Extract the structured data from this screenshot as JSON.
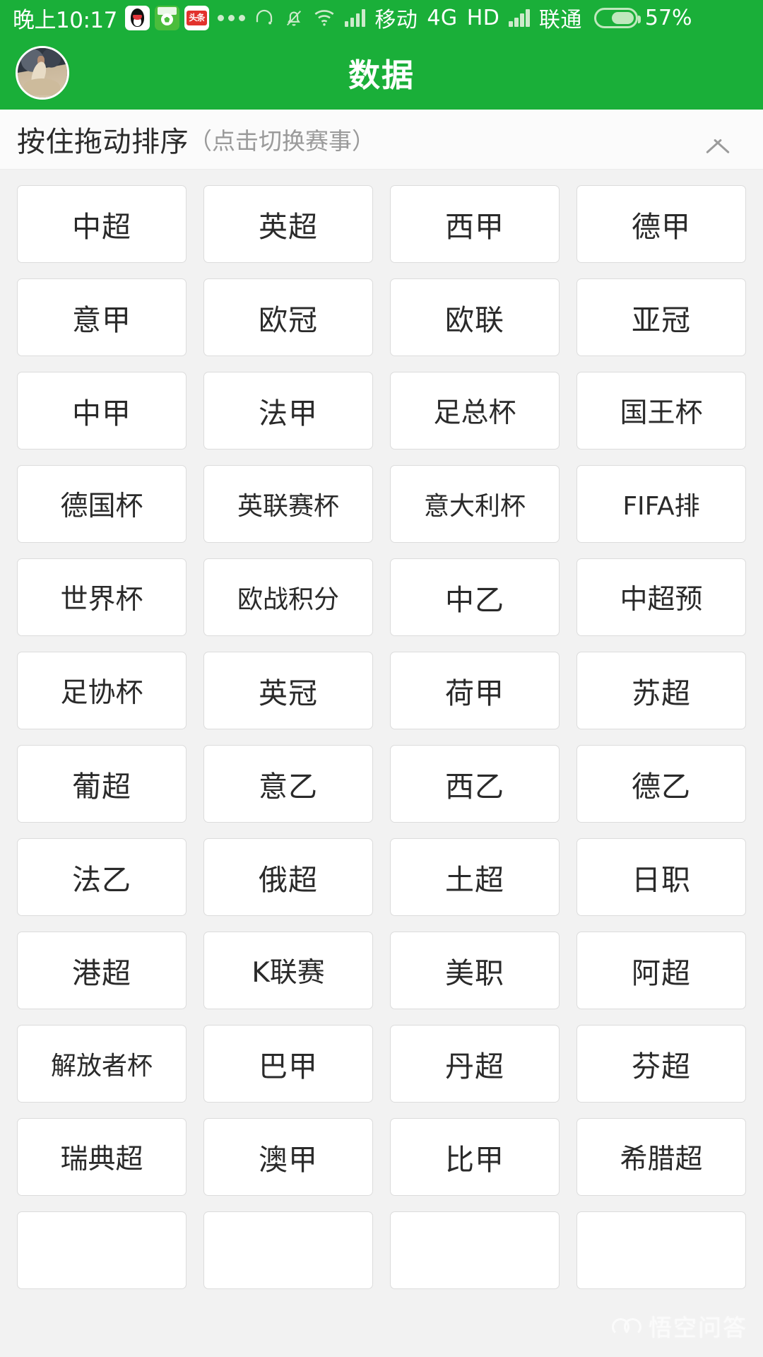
{
  "status_bar": {
    "time": "晚上10:17",
    "app_icons": [
      "qq-icon",
      "football-app-icon",
      "toutiao-icon",
      "more-dots-icon"
    ],
    "toutiao_label": "头条",
    "headset_icon": "headset-icon",
    "mute_icon": "bell-muted-icon",
    "wifi_icon": "wifi-icon",
    "signal_icon_1": "signal-bars-icon",
    "carrier_1": "移动",
    "network_type": "4G",
    "hd_label": "HD",
    "signal_icon_2": "signal-bars-icon",
    "carrier_2": "联通",
    "battery_icon": "battery-icon",
    "battery_percent": "57%"
  },
  "header": {
    "avatar": "user-avatar",
    "title": "数据"
  },
  "section": {
    "title": "按住拖动排序",
    "subtitle": "（点击切换赛事）",
    "collapse_icon": "chevron-up-icon"
  },
  "grid": {
    "columns": 4,
    "leagues": [
      "中超",
      "英超",
      "西甲",
      "德甲",
      "意甲",
      "欧冠",
      "欧联",
      "亚冠",
      "中甲",
      "法甲",
      "足总杯",
      "国王杯",
      "德国杯",
      "英联赛杯",
      "意大利杯",
      "FIFA排",
      "世界杯",
      "欧战积分",
      "中乙",
      "中超预",
      "足协杯",
      "英冠",
      "荷甲",
      "苏超",
      "葡超",
      "意乙",
      "西乙",
      "德乙",
      "法乙",
      "俄超",
      "土超",
      "日职",
      "港超",
      "K联赛",
      "美职",
      "阿超",
      "解放者杯",
      "巴甲",
      "丹超",
      "芬超",
      "瑞典超",
      "澳甲",
      "比甲",
      "希腊超",
      "",
      "",
      "",
      ""
    ]
  },
  "watermark": {
    "text": "悟空问答",
    "logo": "wukong-logo-icon"
  },
  "colors": {
    "brand_green": "#1aaf39",
    "status_text": "#ffffff",
    "page_bg": "#f2f2f2",
    "cell_bg": "#ffffff",
    "cell_border": "#dcdcdc",
    "cell_text": "#2a2a2a",
    "muted_text": "#9a9a9a"
  }
}
